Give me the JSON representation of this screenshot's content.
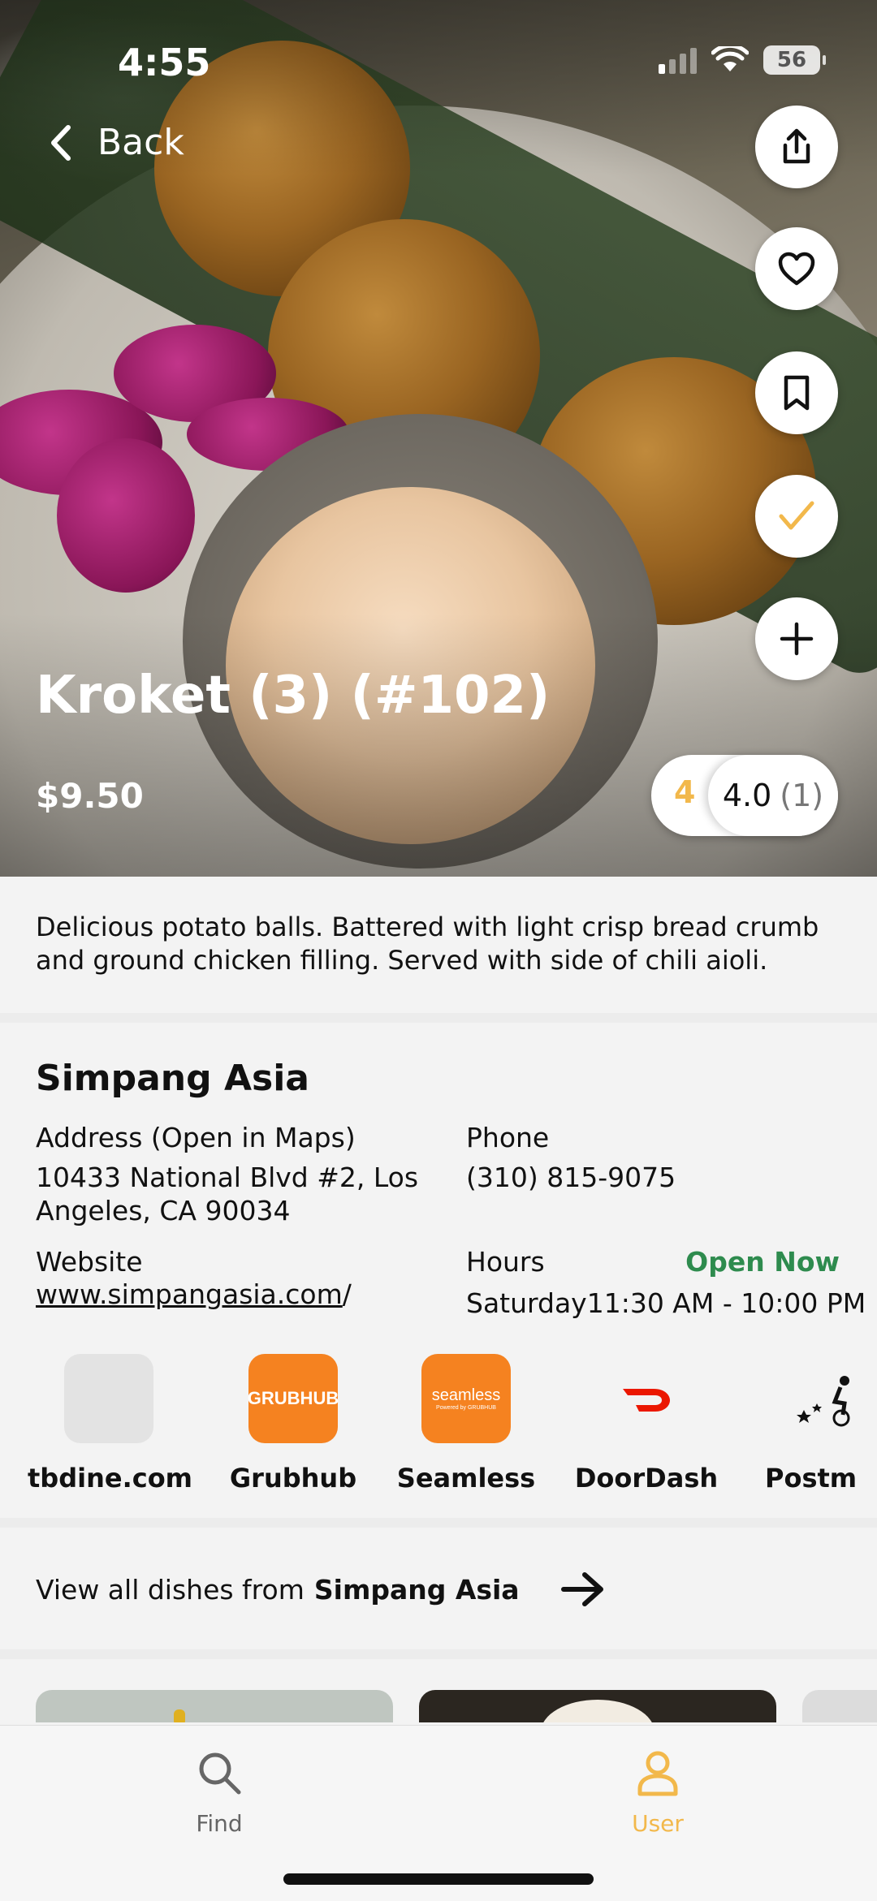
{
  "status_bar": {
    "time": "4:55",
    "battery": "56"
  },
  "nav": {
    "back_label": "Back"
  },
  "hero": {
    "icons": [
      "share-icon",
      "heart-icon",
      "bookmark-icon",
      "check-icon",
      "plus-icon"
    ],
    "check_color": "#f2b84b"
  },
  "dish": {
    "title": "Kroket (3) (#102)",
    "price": "$9.50",
    "my_rating": "4",
    "avg_rating": "4.0",
    "rating_count": "(1)",
    "description": "Delicious potato balls. Battered with light crisp bread crumb and ground chicken filling. Served with side of chili aioli."
  },
  "restaurant": {
    "name": "Simpang Asia",
    "address_label": "Address (Open in Maps)",
    "address_line1": "10433 National Blvd #2, Los",
    "address_line2": "Angeles, CA 90034",
    "phone_label": "Phone",
    "phone": "(310) 815-9075",
    "website_label": "Website",
    "website_link": "www.simpangasia.com",
    "website_suffix": "/",
    "hours_label": "Hours",
    "open_status": "Open Now",
    "hours_day": "Saturday",
    "hours_time": "11:30 AM - 10:00 PM"
  },
  "services": [
    {
      "name": "tbdine.com"
    },
    {
      "name": "Grubhub",
      "logo_text": "GRUBHUB",
      "color": "#f58220"
    },
    {
      "name": "Seamless",
      "logo_text": "seamless",
      "logo_sub": "Powered by GRUBHUB",
      "color": "#f58220"
    },
    {
      "name": "DoorDash",
      "color": "#eb1700"
    },
    {
      "name": "Postm"
    }
  ],
  "view_all": {
    "prefix": "View all dishes from",
    "restaurant": "Simpang Asia"
  },
  "tabbar": {
    "find": "Find",
    "user": "User",
    "active_color": "#f2b84b"
  }
}
